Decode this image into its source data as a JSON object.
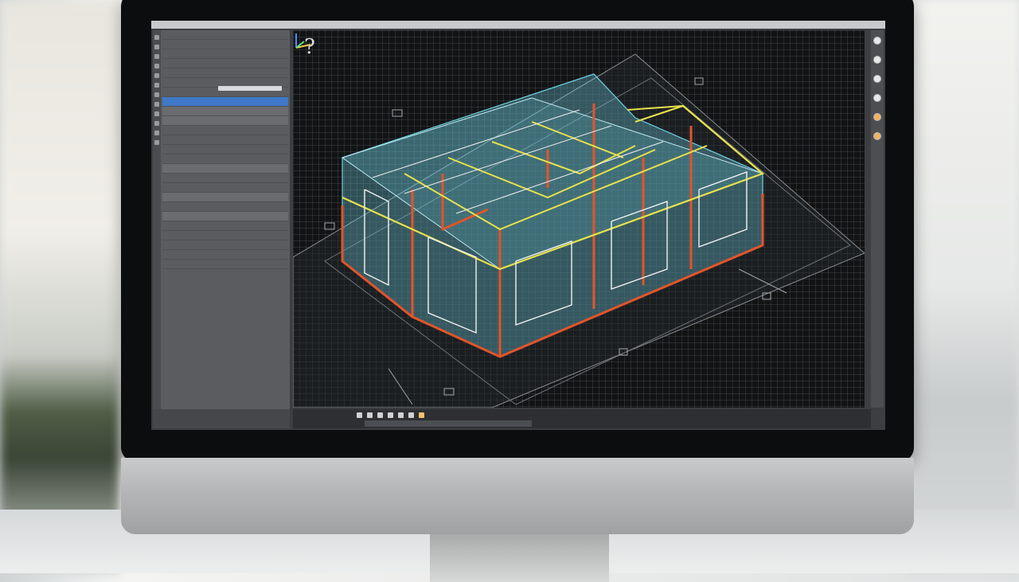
{
  "scene": {
    "accent": "#3f79c8",
    "wire_cyan": "#6fd3e6",
    "wire_orange": "#e2552a",
    "wire_yellow": "#e7e24a",
    "wire_white": "#f2f2f2"
  },
  "left_panel": {
    "rows": [
      {
        "label": "",
        "selected": false
      },
      {
        "label": "",
        "selected": false
      },
      {
        "label": "",
        "selected": false
      },
      {
        "label": "",
        "selected": false
      },
      {
        "label": "",
        "selected": false
      },
      {
        "label": "",
        "selected": false
      },
      {
        "label": "",
        "selected": false
      },
      {
        "label": "",
        "selected": true
      },
      {
        "label": "",
        "selected": false
      },
      {
        "label": "",
        "selected": false
      }
    ]
  },
  "viewport": {
    "overlay_symbol": "?",
    "icons": {
      "axis_gizmo": "axis-gizmo-icon"
    }
  },
  "right_toolbar": {
    "buttons": [
      "orbit-icon",
      "pan-icon",
      "zoom-icon",
      "view-cube-icon",
      "sun-icon",
      "render-icon"
    ]
  },
  "bottom_bar": {
    "tools": [
      "undo-icon",
      "redo-icon",
      "snap-icon",
      "grid-icon",
      "ortho-icon",
      "measure-icon",
      "layer-icon"
    ]
  }
}
